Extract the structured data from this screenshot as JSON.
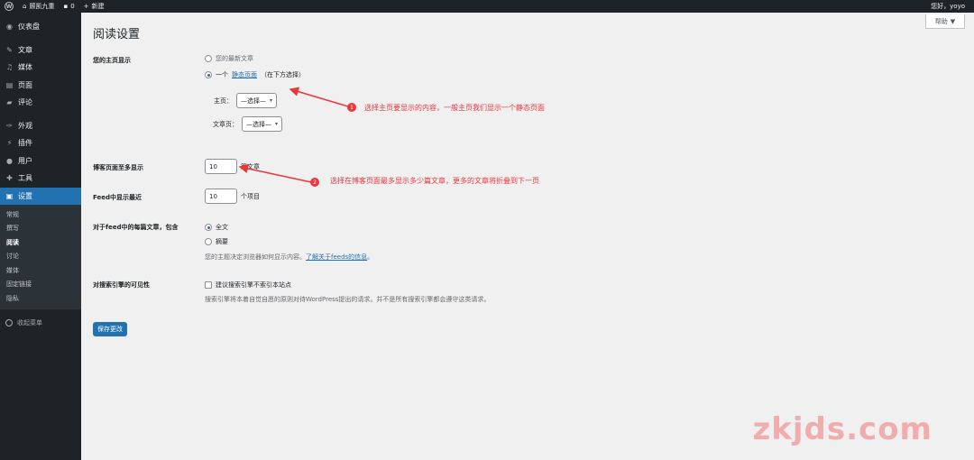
{
  "adminbar": {
    "site_name": "顾凯九重",
    "comments_count": "0",
    "new_label": "新建",
    "greeting": "您好，yoyo"
  },
  "sidebar": {
    "items": [
      {
        "label": "仪表盘",
        "icon": "dashboard-icon"
      },
      {
        "label": "文章",
        "icon": "pin-icon"
      },
      {
        "label": "媒体",
        "icon": "media-icon"
      },
      {
        "label": "页面",
        "icon": "page-icon"
      },
      {
        "label": "评论",
        "icon": "comment-icon"
      },
      {
        "label": "外观",
        "icon": "brush-icon"
      },
      {
        "label": "插件",
        "icon": "plugin-icon"
      },
      {
        "label": "用户",
        "icon": "user-icon"
      },
      {
        "label": "工具",
        "icon": "wrench-icon"
      },
      {
        "label": "设置",
        "icon": "settings-icon"
      }
    ],
    "submenu": [
      "常规",
      "撰写",
      "阅读",
      "讨论",
      "媒体",
      "固定链接",
      "隐私"
    ],
    "collapse_label": "收起菜单"
  },
  "main": {
    "help_label": "帮助",
    "title": "阅读设置",
    "homepage": {
      "label": "您的主页显示",
      "option_latest": "您的最新文章",
      "option_static_prefix": "一个",
      "option_static_link": "静态页面",
      "option_static_suffix": "（在下方选择）",
      "homepage_label": "主页：",
      "homepage_value": "—选择—",
      "postspage_label": "文章页：",
      "postspage_value": "—选择—"
    },
    "posts_per_page": {
      "label": "博客页面至多显示",
      "value": "10",
      "unit": "篇文章"
    },
    "feed_items": {
      "label": "Feed中显示最近",
      "value": "10",
      "unit": "个项目"
    },
    "feed_content": {
      "label": "对于feed中的每篇文章，包含",
      "option_full": "全文",
      "option_excerpt": "摘要",
      "desc_prefix": "您的主题决定浏览器如何显示内容。",
      "desc_link": "了解关于feeds的信息",
      "desc_suffix": "。"
    },
    "visibility": {
      "label": "对搜索引擎的可见性",
      "checkbox_label": "建议搜索引擎不索引本站点",
      "desc": "搜索引擎将本着自觉自愿的原则对待WordPress提出的请求。并不是所有搜索引擎都会遵守这类请求。"
    },
    "save_label": "保存更改"
  },
  "annotations": {
    "badge1": "1",
    "text1": "选择主页要显示的内容，一般主页我们显示一个静态页面",
    "badge2": "2",
    "text2": "选择在博客页面最多显示多少篇文章，更多的文章将折叠到下一页",
    "color": "#e8383d"
  },
  "watermark": "zkjds.com",
  "colors": {
    "accent": "#2271b1",
    "sidebar_bg": "#1d2327",
    "content_bg": "#f0f0f1"
  }
}
